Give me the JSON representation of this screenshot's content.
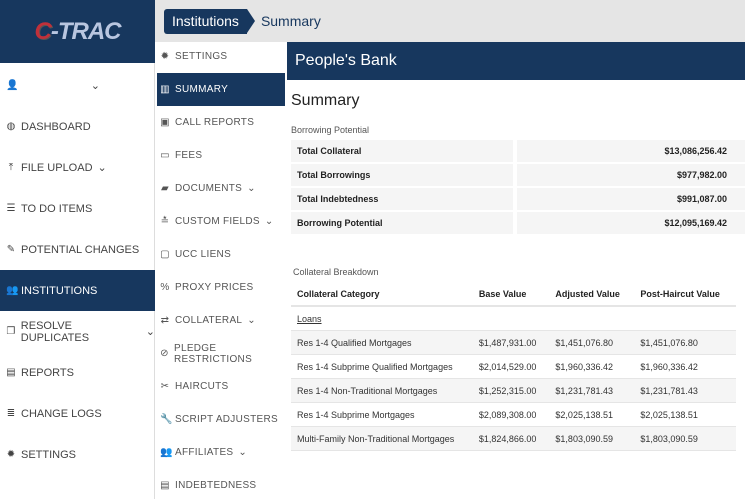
{
  "logo": {
    "text_c": "C",
    "text_rest": "-TRAC"
  },
  "breadcrumb": [
    "Institutions",
    "Summary"
  ],
  "sidebar": {
    "user_item": "",
    "items": [
      {
        "label": "DASHBOARD",
        "icon": "dashboard-icon",
        "glyph": "◍"
      },
      {
        "label": "FILE UPLOAD",
        "icon": "upload-icon",
        "glyph": "⤒",
        "chevron": true
      },
      {
        "label": "TO DO ITEMS",
        "icon": "list-icon",
        "glyph": "☰"
      },
      {
        "label": "POTENTIAL CHANGES",
        "icon": "pencil-icon",
        "glyph": "✎"
      },
      {
        "label": "INSTITUTIONS",
        "icon": "users-icon",
        "glyph": "👥",
        "active": true
      },
      {
        "label": "RESOLVE DUPLICATES",
        "icon": "copy-icon",
        "glyph": "❐",
        "chevron": true
      },
      {
        "label": "REPORTS",
        "icon": "file-icon",
        "glyph": "▤"
      },
      {
        "label": "CHANGE LOGS",
        "icon": "database-icon",
        "glyph": "≣"
      },
      {
        "label": "SETTINGS",
        "icon": "gear-icon",
        "glyph": "✹"
      }
    ]
  },
  "subnav": [
    {
      "label": "SETTINGS",
      "icon": "gear-icon",
      "glyph": "✹"
    },
    {
      "label": "SUMMARY",
      "icon": "bar-chart-icon",
      "glyph": "▥",
      "active": true
    },
    {
      "label": "CALL REPORTS",
      "icon": "report-icon",
      "glyph": "▣"
    },
    {
      "label": "FEES",
      "icon": "money-icon",
      "glyph": "▭"
    },
    {
      "label": "DOCUMENTS",
      "icon": "folder-icon",
      "glyph": "▰",
      "chevron": true
    },
    {
      "label": "CUSTOM FIELDS",
      "icon": "stamp-icon",
      "glyph": "≛",
      "chevron": true
    },
    {
      "label": "UCC LIENS",
      "icon": "lien-icon",
      "glyph": "▢"
    },
    {
      "label": "PROXY PRICES",
      "icon": "percent-icon",
      "glyph": "%"
    },
    {
      "label": "COLLATERAL",
      "icon": "exchange-icon",
      "glyph": "⇄",
      "chevron": true
    },
    {
      "label": "PLEDGE RESTRICTIONS",
      "icon": "ban-icon",
      "glyph": "⊘"
    },
    {
      "label": "HAIRCUTS",
      "icon": "scissors-icon",
      "glyph": "✂"
    },
    {
      "label": "SCRIPT ADJUSTERS",
      "icon": "wrench-icon",
      "glyph": "🔧"
    },
    {
      "label": "AFFILIATES",
      "icon": "users-icon",
      "glyph": "👥",
      "chevron": true
    },
    {
      "label": "INDEBTEDNESS",
      "icon": "indebtedness-icon",
      "glyph": "▤"
    }
  ],
  "main": {
    "bank": "People's Bank",
    "title": "Summary",
    "borrowing_label": "Borrowing Potential",
    "borrowing": [
      [
        "Total Collateral",
        "$13,086,256.42"
      ],
      [
        "Total Borrowings",
        "$977,982.00"
      ],
      [
        "Total Indebtedness",
        "$991,087.00"
      ],
      [
        "Borrowing Potential",
        "$12,095,169.42"
      ]
    ],
    "breakdown_label": "Collateral Breakdown",
    "columns": [
      "Collateral Category",
      "Base Value",
      "Adjusted Value",
      "Post-Haircut Value"
    ],
    "group": "Loans",
    "rows": [
      [
        "Res 1-4 Qualified Mortgages",
        "$1,487,931.00",
        "$1,451,076.80",
        "$1,451,076.80"
      ],
      [
        "Res 1-4 Subprime Qualified Mortgages",
        "$2,014,529.00",
        "$1,960,336.42",
        "$1,960,336.42"
      ],
      [
        "Res 1-4 Non-Traditional Mortgages",
        "$1,252,315.00",
        "$1,231,781.43",
        "$1,231,781.43"
      ],
      [
        "Res 1-4 Subprime Mortgages",
        "$2,089,308.00",
        "$2,025,138.51",
        "$2,025,138.51"
      ],
      [
        "Multi-Family Non-Traditional Mortgages",
        "$1,824,866.00",
        "$1,803,090.59",
        "$1,803,090.59"
      ]
    ]
  }
}
